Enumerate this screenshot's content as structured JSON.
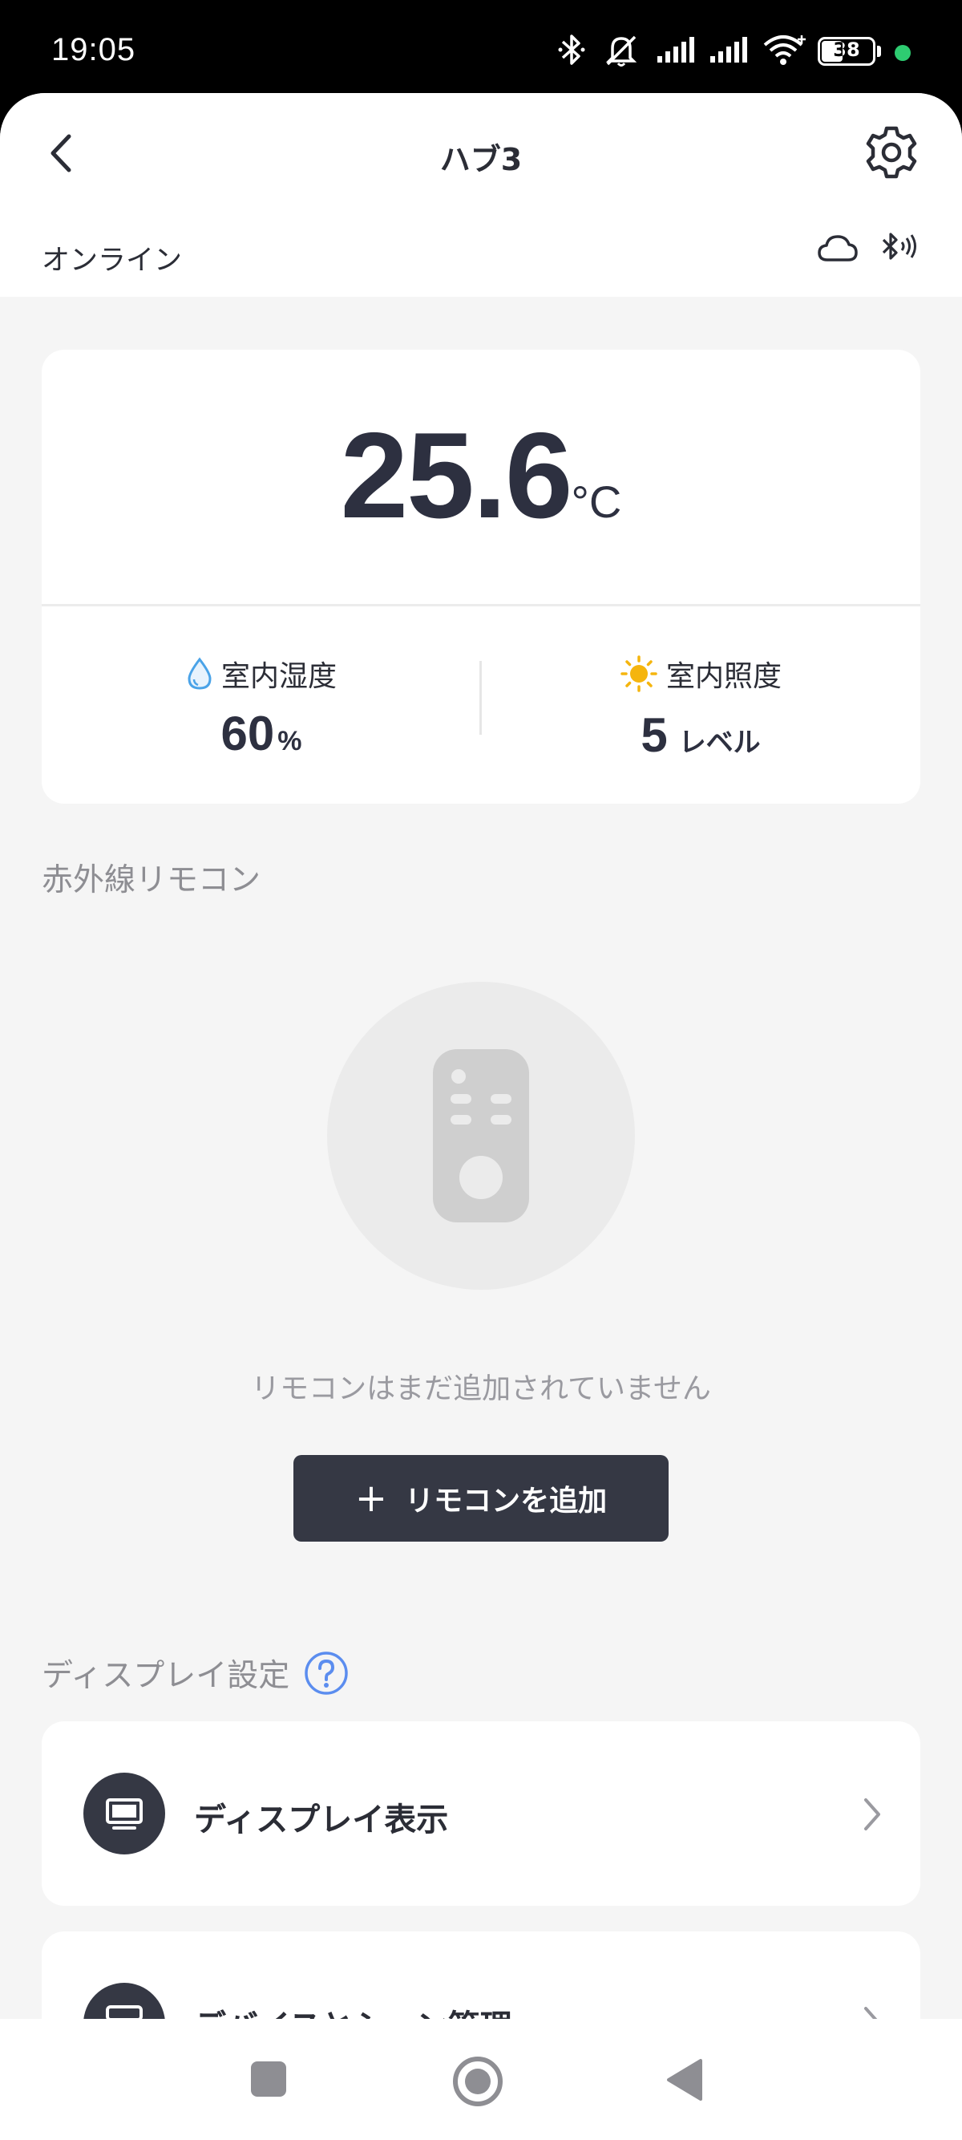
{
  "status_bar": {
    "time": "19:05",
    "battery": "38",
    "icons": [
      "bluetooth-icon",
      "mute-icon",
      "signal-icon",
      "signal-icon",
      "wifi-icon",
      "battery-icon",
      "dot-icon"
    ],
    "dot_color": "#2ecc71"
  },
  "header": {
    "title": "ハブ3",
    "status": "オンライン"
  },
  "sensors": {
    "temperature": "25.6",
    "temperature_unit": "°C",
    "humidity_label": "室内湿度",
    "humidity_value": "60",
    "humidity_unit": "%",
    "illuminance_label": "室内照度",
    "illuminance_value": "5",
    "illuminance_unit": "レベル"
  },
  "ir_remote": {
    "section_title": "赤外線リモコン",
    "empty_message": "リモコンはまだ追加されていません",
    "add_button_label": "リモコンを追加"
  },
  "display_settings": {
    "section_title": "ディスプレイ設定",
    "items": [
      {
        "label": "ディスプレイ表示",
        "icon": "monitor-icon"
      },
      {
        "label": "デバイスとシーン管理",
        "icon": "device-icon"
      }
    ]
  },
  "colors": {
    "accent": "#5b8def",
    "dark": "#353844",
    "background": "#f5f5f5"
  }
}
